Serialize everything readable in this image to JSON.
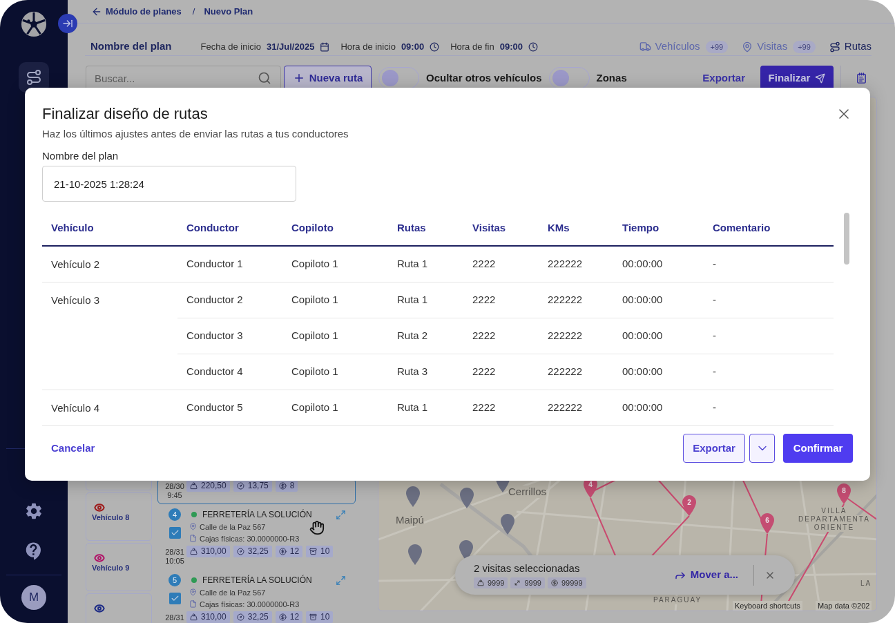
{
  "sidebar": {
    "avatar": "M"
  },
  "breadcrumb": {
    "back": "Módulo de planes",
    "separator": "/",
    "current": "Nuevo Plan"
  },
  "plan_header": {
    "title": "Nombre del plan",
    "fields": [
      {
        "kind": "date",
        "label": "Fecha de inicio",
        "value": "31/Jul/2025"
      },
      {
        "kind": "time",
        "label": "Hora de inicio",
        "value": "09:00"
      },
      {
        "kind": "time",
        "label": "Hora de fin",
        "value": "09:00"
      }
    ],
    "tabs": [
      {
        "kind": "vehicles",
        "label": "Vehículos",
        "badge": "+99",
        "selected": false
      },
      {
        "kind": "visits",
        "label": "Visitas",
        "badge": "+99",
        "selected": false
      },
      {
        "kind": "routes",
        "label": "Rutas",
        "selected": true
      }
    ]
  },
  "toolbar": {
    "search": {
      "placeholder": "Buscar..."
    },
    "new_route": "Nueva ruta",
    "toggles": [
      {
        "label": "Ocultar otros vehículos",
        "on": false
      },
      {
        "label": "Zonas",
        "on": false
      }
    ],
    "export": "Exportar",
    "finish": "Finalizar"
  },
  "vehicles": [
    {
      "label": "Vehículo 8",
      "color": "#9e1c1c"
    },
    {
      "label": "Vehículo 9",
      "color": "#b01468"
    },
    {
      "color": "#1e2c86"
    }
  ],
  "visits": [
    {
      "selected": true,
      "date": "28/30",
      "time": "9:45",
      "metrics": [
        {
          "kind": "weight",
          "value": "220,50"
        },
        {
          "kind": "distance",
          "value": "13,75"
        },
        {
          "kind": "money",
          "value": "8"
        }
      ]
    },
    {
      "selected": false,
      "number": "4",
      "color": "#2f9a55",
      "name": "FERRETERÍA LA SOLUCIÓN",
      "address": "Calle de la Paz 567",
      "note": "Cajas físicas: 30.0000000-R3",
      "checked": true,
      "date": "28/31",
      "time": "10:05",
      "metrics": [
        {
          "kind": "weight",
          "value": "310,00"
        },
        {
          "kind": "distance",
          "value": "32,25"
        },
        {
          "kind": "money",
          "value": "12"
        },
        {
          "kind": "boxes",
          "value": "10"
        }
      ]
    },
    {
      "selected": false,
      "number": "5",
      "color": "#2f9a55",
      "name": "FERRETERÍA LA SOLUCIÓN",
      "address": "Calle de la Paz 567",
      "note": "Cajas físicas: 30.0000000-R3",
      "checked": true,
      "date": "28/31",
      "metrics": [
        {
          "kind": "weight",
          "value": "310,00"
        },
        {
          "kind": "distance",
          "value": "32,25"
        },
        {
          "kind": "money",
          "value": "12"
        },
        {
          "kind": "boxes",
          "value": "10"
        }
      ]
    }
  ],
  "map": {
    "labels": [
      {
        "lines": [
          "Cerrillos"
        ]
      },
      {
        "lines": [
          "Maipú"
        ]
      },
      {
        "lines": [
          "VILLA",
          "DEPARTAMENTA",
          "ORIENTE"
        ]
      },
      {
        "lines": [
          "LA"
        ]
      },
      {
        "lines": [
          "PARAGUAY"
        ]
      }
    ],
    "route_markers": [
      {
        "label": "4"
      },
      {
        "label": "2"
      },
      {
        "label": "6"
      },
      {
        "label": "8"
      }
    ],
    "selection_bar": {
      "title": "2 visitas seleccionadas",
      "metrics": [
        {
          "kind": "weight",
          "value": "9999"
        },
        {
          "kind": "volume",
          "value": "9999"
        },
        {
          "kind": "money",
          "value": "99999"
        }
      ],
      "action": "Mover a..."
    },
    "attribution": [
      "Keyboard shortcuts",
      "Map data ©202"
    ]
  },
  "modal": {
    "title": "Finalizar diseño de rutas",
    "subtitle": "Haz los últimos ajustes antes de enviar las rutas a tus conductores",
    "name_field": {
      "label": "Nombre del plan",
      "value": "21-10-2025 1:28:24"
    },
    "table": {
      "columns": [
        "Vehículo",
        "Conductor",
        "Copiloto",
        "Rutas",
        "Visitas",
        "KMs",
        "Tiempo",
        "Comentario"
      ],
      "rows": [
        {
          "vehicle": "Vehículo 2",
          "routes": [
            {
              "cells": [
                "Conductor 1",
                "Copiloto 1",
                "Ruta 1",
                "2222",
                "222222",
                "00:00:00",
                "-"
              ]
            }
          ]
        },
        {
          "vehicle": "Vehículo 3",
          "routes": [
            {
              "cells": [
                "Conductor 2",
                "Copiloto 1",
                "Ruta 1",
                "2222",
                "222222",
                "00:00:00",
                "-"
              ]
            },
            {
              "cells": [
                "Conductor 3",
                "Copiloto 1",
                "Ruta 2",
                "2222",
                "222222",
                "00:00:00",
                "-"
              ]
            },
            {
              "cells": [
                "Conductor 4",
                "Copiloto 1",
                "Ruta 3",
                "2222",
                "222222",
                "00:00:00",
                "-"
              ]
            }
          ]
        },
        {
          "vehicle": "Vehículo 4",
          "routes": [
            {
              "cells": [
                "Conductor 5",
                "Copiloto 1",
                "Ruta 1",
                "2222",
                "222222",
                "00:00:00",
                "-"
              ]
            }
          ]
        }
      ]
    },
    "cancel": "Cancelar",
    "export": "Exportar",
    "confirm": "Confirmar"
  }
}
